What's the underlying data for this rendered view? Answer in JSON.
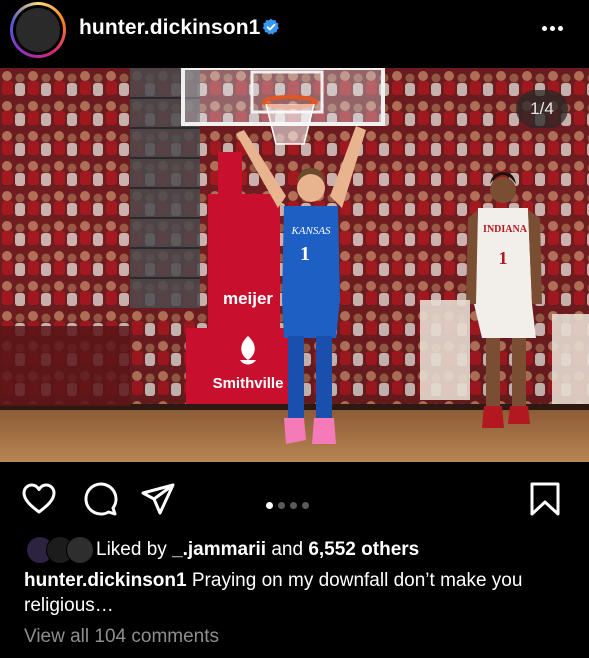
{
  "post": {
    "username": "hunter.dickinson1",
    "verified": true,
    "image_counter": "1/4",
    "current_image": 1,
    "total_images": 4
  },
  "likes": {
    "prefix": "Liked by",
    "first_liker": "_.jammarii",
    "joiner": "and",
    "others": "6,552 others"
  },
  "caption": {
    "username": "hunter.dickinson1",
    "text": "Praying on my downfall don’t make you religious…"
  },
  "comments": {
    "view_all": "View all 104 comments"
  },
  "photo": {
    "jersey_left_team": "KANSAS",
    "jersey_left_number": "1",
    "jersey_right_team": "INDIANA",
    "jersey_right_number": "1",
    "stanchion_text_top": "meijer",
    "stanchion_text_bottom": "Smithville"
  },
  "icons": {
    "like": "heart-icon",
    "comment": "comment-icon",
    "share": "paper-plane-icon",
    "save": "bookmark-icon",
    "more": "more-dots-icon",
    "verified": "verified-badge-icon"
  },
  "colors": {
    "background": "#000000",
    "verified_blue": "#3797f0",
    "muted_text": "#8e8e8e"
  }
}
